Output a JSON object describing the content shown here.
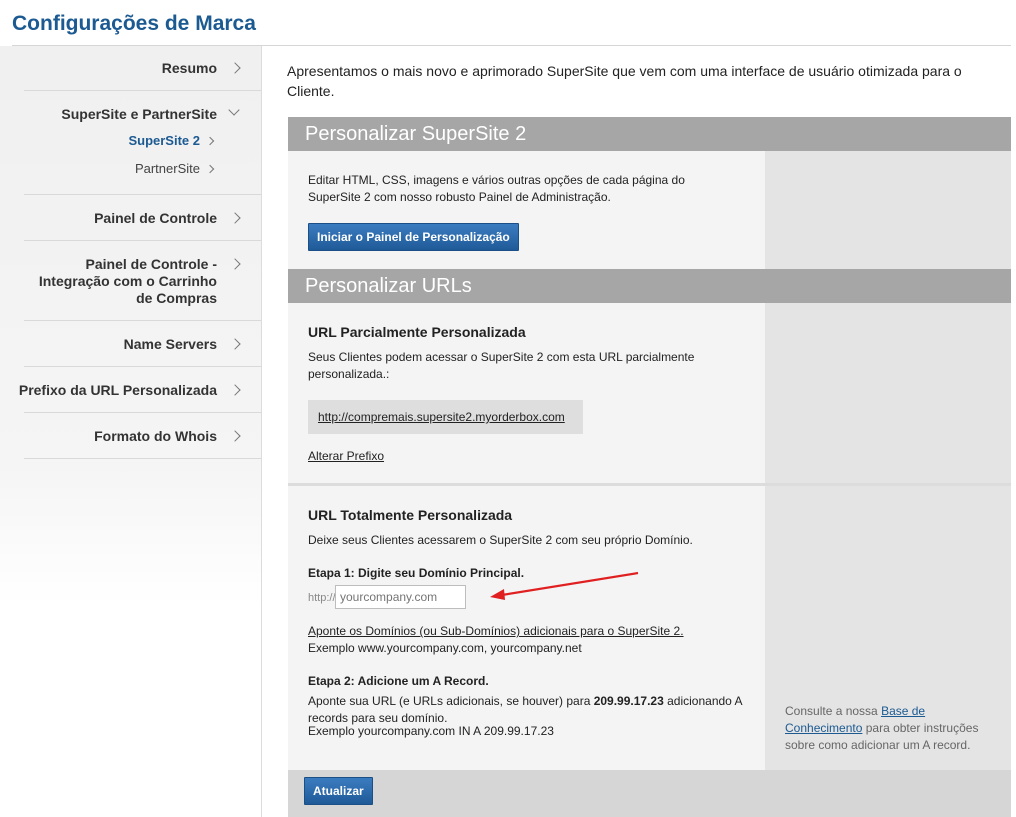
{
  "page_title": "Configurações de Marca",
  "sidebar": {
    "items": [
      {
        "label": "Resumo"
      },
      {
        "label": "SuperSite e PartnerSite"
      },
      {
        "label": "Painel de Controle"
      },
      {
        "label": "Painel de Controle - Integração com o Carrinho de Compras"
      },
      {
        "label": "Name Servers"
      },
      {
        "label": "Prefixo da URL Personalizada"
      },
      {
        "label": "Formato do Whois"
      }
    ],
    "subitems": [
      {
        "label": "SuperSite 2",
        "active": true
      },
      {
        "label": "PartnerSite",
        "active": false
      }
    ]
  },
  "intro": "Apresentamos o mais novo e aprimorado SuperSite que vem com uma interface de usuário otimizada para o Cliente.",
  "customize_supersite": {
    "heading": "Personalizar SuperSite 2",
    "description": "Editar HTML, CSS, imagens e vários outras opções de cada página do SuperSite 2 com nosso robusto Painel de Administração.",
    "button_label": "Iniciar o Painel de Personalização"
  },
  "customize_urls": {
    "heading": "Personalizar URLs",
    "partial": {
      "title": "URL Parcialmente Personalizada",
      "description": "Seus Clientes podem acessar o SuperSite 2 com esta URL parcialmente personalizada.:",
      "url": "http://compremais.supersite2.myorderbox.com",
      "change_prefix": "Alterar Prefixo"
    },
    "full": {
      "title": "URL Totalmente Personalizada",
      "description": "Deixe seus Clientes acessarem o SuperSite 2 com seu próprio Domínio.",
      "step1_label": "Etapa 1: Digite seu Domínio Principal.",
      "input_prefix": "http://",
      "input_placeholder": "yourcompany.com",
      "point_link": "Aponte os Domínios (ou Sub-Domínios) adicionais para o SuperSite 2.",
      "example1": "Exemplo www.yourcompany.com, yourcompany.net",
      "step2_label": "Etapa 2: Adicione um A Record.",
      "step2_text_before": "Aponte sua URL (e URLs adicionais, se houver) para ",
      "ip": "209.99.17.23",
      "step2_text_after": " adicionando A records para seu domínio.",
      "example2": "Exemplo yourcompany.com IN A 209.99.17.23"
    },
    "kb_note_before": "Consulte a nossa ",
    "kb_link": "Base de Conhecimento",
    "kb_note_after": " para obter instruções sobre como adicionar um A record."
  },
  "update_button": "Atualizar",
  "colors": {
    "title": "#1c5a92",
    "panel_header": "#a6a6a6",
    "button": "#2a6aae",
    "annotation_arrow": "#e02020"
  }
}
